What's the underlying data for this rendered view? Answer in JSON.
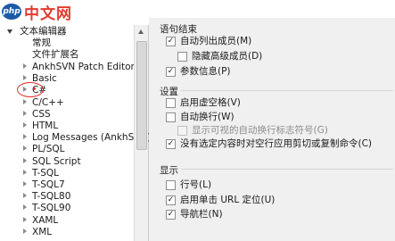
{
  "watermark": {
    "logo": "php",
    "text": "中文网"
  },
  "tree": {
    "items": [
      {
        "label": "文本编辑器",
        "expanded": true
      },
      {
        "label": "常规"
      },
      {
        "label": "文件扩展名"
      },
      {
        "label": "AnkhSVN Patch Editor"
      },
      {
        "label": "Basic"
      },
      {
        "label": "C#"
      },
      {
        "label": "C/C++"
      },
      {
        "label": "CSS"
      },
      {
        "label": "HTML"
      },
      {
        "label": "Log Messages (AnkhSVN)"
      },
      {
        "label": "PL/SQL"
      },
      {
        "label": "SQL Script"
      },
      {
        "label": "T-SQL"
      },
      {
        "label": "T-SQL7"
      },
      {
        "label": "T-SQL80"
      },
      {
        "label": "T-SQL90"
      },
      {
        "label": "XAML"
      },
      {
        "label": "XML"
      }
    ]
  },
  "options": {
    "statement_completion": {
      "title": "语句结束",
      "items": [
        {
          "label": "自动列出成员(M)",
          "checked": true,
          "enabled": true
        },
        {
          "label": "隐藏高级成员(D)",
          "checked": false,
          "enabled": true
        },
        {
          "label": "参数信息(P)",
          "checked": true,
          "enabled": true
        }
      ]
    },
    "settings": {
      "title": "设置",
      "items": [
        {
          "label": "启用虚空格(V)",
          "checked": false,
          "enabled": true
        },
        {
          "label": "自动换行(W)",
          "checked": false,
          "enabled": true
        },
        {
          "label": "显示可视的自动换行标志符号(G)",
          "checked": false,
          "enabled": false
        },
        {
          "label": "没有选定内容时对空行应用剪切或复制命令(C)",
          "checked": true,
          "enabled": true
        }
      ]
    },
    "display": {
      "title": "显示",
      "items": [
        {
          "label": "行号(L)",
          "checked": false,
          "enabled": true
        },
        {
          "label": "启用单击 URL 定位(U)",
          "checked": true,
          "enabled": true
        },
        {
          "label": "导航栏(N)",
          "checked": true,
          "enabled": true
        }
      ]
    }
  },
  "colors": {
    "highlight": "#e0302a",
    "panel_bg": "#f0f0f0"
  },
  "icons": {
    "checkmark": "✓"
  }
}
